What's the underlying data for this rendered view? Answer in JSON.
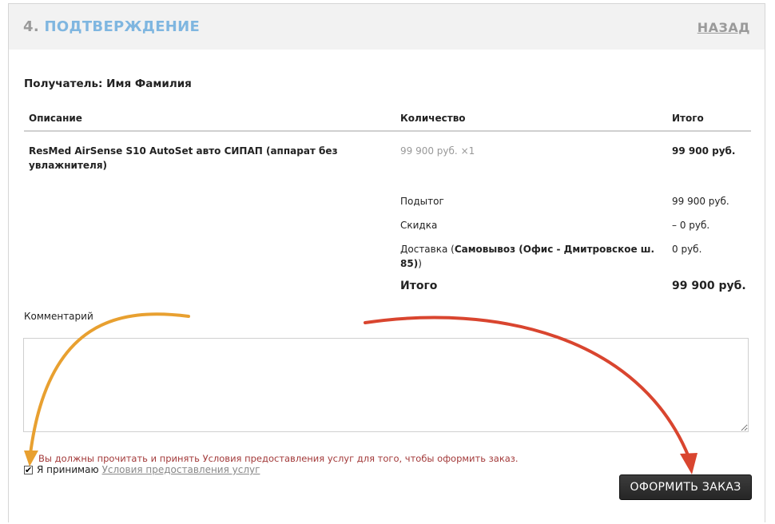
{
  "header": {
    "step_number": "4.",
    "step_title": "ПОДТВЕРЖДЕНИЕ",
    "back_label": "НАЗАД"
  },
  "recipient": "Получатель: Имя Фамилия",
  "table": {
    "headers": [
      "Описание",
      "Количество",
      "Итого"
    ],
    "rows": [
      {
        "description_line1": "ResMed AirSense S10 AutoSet авто СИПАП (аппарат без",
        "description_line2": "увлажнителя)",
        "price": "99 900 руб.",
        "qty": "×1",
        "total": "99 900 руб."
      }
    ]
  },
  "summary": {
    "subtotal_label": "Подытог",
    "subtotal_value": "99 900 руб.",
    "discount_label": "Скидка",
    "discount_value": "– 0 руб.",
    "delivery_label_prefix": "Доставка (",
    "delivery_method_line1": "Самовывоз (Офис - Дмитровское ш.",
    "delivery_method_line2": "85)",
    "delivery_label_suffix": ")",
    "delivery_value": "0 руб.",
    "total_label": "Итого",
    "total_value": "99 900 руб."
  },
  "comment": {
    "label": "Комментарий",
    "value": ""
  },
  "terms": {
    "warning": "Вы должны прочитать и принять Условия предоставления услуг для того, чтобы оформить заказ.",
    "accept_label": "Я принимаю",
    "link_label": "Условия предоставления услуг",
    "checked": true
  },
  "order_button": "ОФОРМИТЬ ЗАКАЗ",
  "colors": {
    "accent_title": "#7fb6e0",
    "warning_text": "#a33a3a",
    "arrow_orange": "#e8a030",
    "arrow_red": "#d9452f"
  },
  "icons": [
    "checkmark-icon",
    "resize-grip-icon",
    "orange-arrow-annotation",
    "red-arrow-annotation"
  ]
}
